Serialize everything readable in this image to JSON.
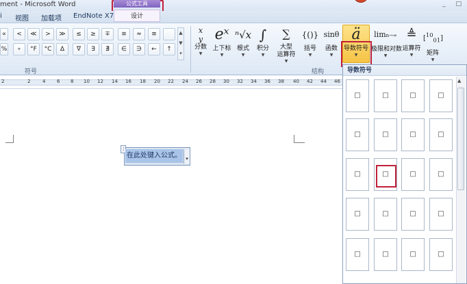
{
  "window": {
    "title": "ment - Microsoft Word",
    "controls": "_ □"
  },
  "contextual_tab": {
    "group_header": "公式工具",
    "tab_design": "设计"
  },
  "tabs": [
    {
      "label": "i"
    },
    {
      "label": "视图"
    },
    {
      "label": "加载项"
    },
    {
      "label": "EndNote X7"
    }
  ],
  "symbols": {
    "row1": [
      "∝",
      "<",
      "≪",
      ">",
      "≫",
      "≤",
      "≥",
      "∓",
      "≅",
      "≈",
      "≡"
    ],
    "row2": [
      "%",
      "∘",
      "°F",
      "°C",
      "∆",
      "∇",
      "∃",
      "∄",
      "∈",
      "∋",
      "←",
      "↑"
    ],
    "scroll_up": "▲",
    "scroll_down": "▼",
    "scroll_more": "▾",
    "group_label": "符号"
  },
  "structures": {
    "group_label": "结构",
    "buttons": [
      {
        "icon": "x/y",
        "label": "分数"
      },
      {
        "icon": "eˣ",
        "label": "上下标"
      },
      {
        "icon": "ⁿ√x",
        "label": "根式"
      },
      {
        "icon": "∫",
        "label": "积分"
      },
      {
        "icon": "∑",
        "label": "大型",
        "label2": "运算符"
      },
      {
        "icon": "{()}",
        "label": "括号"
      },
      {
        "icon": "sinθ",
        "label": "函数"
      },
      {
        "icon": "ä",
        "label": "导数符号"
      },
      {
        "icon": "lim",
        "label": "极限和对数"
      },
      {
        "icon": "≜",
        "label": "运算符"
      },
      {
        "icon": "[10/01]",
        "label": "矩阵"
      }
    ]
  },
  "ruler": {
    "numbers": [
      "2",
      "2",
      "4",
      "6",
      "8",
      "10",
      "12",
      "14",
      "16",
      "18",
      "20",
      "22",
      "24",
      "26",
      "28",
      "30",
      "32",
      "34",
      "36",
      "38",
      "40",
      "42",
      "44",
      "46"
    ]
  },
  "equation": {
    "placeholder": "在此处键入公式。",
    "handle": "⋮",
    "dropdown": "▾"
  },
  "accent_panel": {
    "title": "导数符号",
    "cell_symbol": "□",
    "scroll_up": "▲"
  }
}
